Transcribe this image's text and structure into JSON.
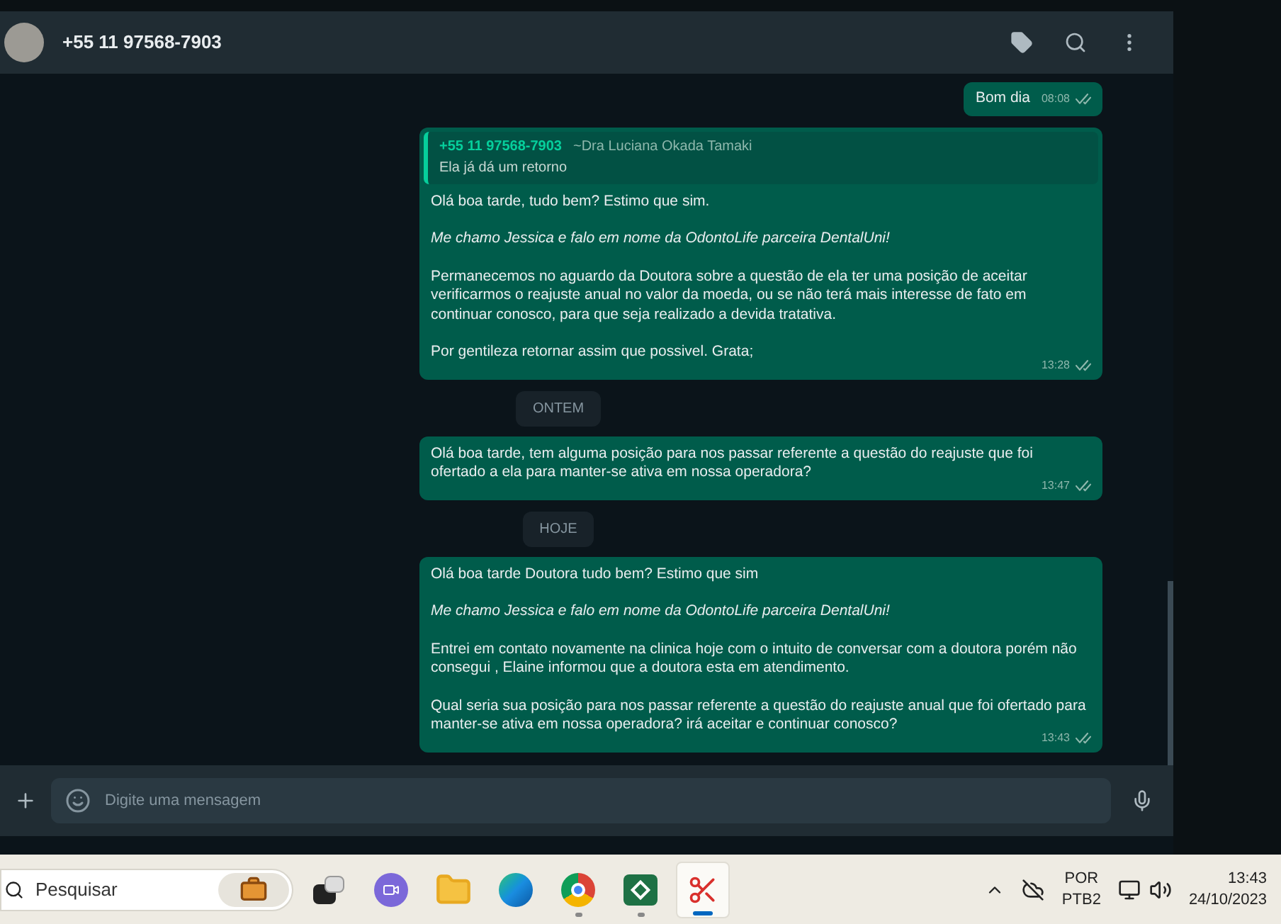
{
  "header": {
    "title": "+55 11 97568-7903"
  },
  "messages": [
    {
      "kind": "plain",
      "paragraphs": [
        {
          "kind": "plain",
          "text": "Bom dia"
        }
      ],
      "time": "08:08",
      "read": true
    },
    {
      "kind": "reply",
      "quote": {
        "sender": "+55 11 97568-7903",
        "name": "~Dra Luciana Okada Tamaki",
        "text": "Ela já dá um retorno"
      },
      "paragraphs": [
        {
          "kind": "plain",
          "text": "Olá boa tarde, tudo bem? Estimo que sim."
        },
        {
          "kind": "italic",
          "text": "Me chamo Jessica e falo em nome da OdontoLife parceira DentalUni!"
        },
        {
          "kind": "plain",
          "text": "Permanecemos no aguardo da Doutora sobre a questão de ela ter uma posição de aceitar verificarmos o reajuste anual no valor da moeda, ou se não terá mais interesse de fato em continuar conosco, para que seja realizado a devida tratativa."
        },
        {
          "kind": "plain",
          "text": "Por gentileza retornar assim que possivel. Grata;"
        }
      ],
      "time": "13:28",
      "read": true
    },
    {
      "kind": "date",
      "text": "ONTEM"
    },
    {
      "kind": "plain",
      "paragraphs": [
        {
          "kind": "plain",
          "text": "Olá boa tarde, tem alguma posição para nos passar referente a questão do reajuste que foi ofertado a ela para manter-se ativa em nossa operadora?"
        }
      ],
      "time": "13:47",
      "read": true
    },
    {
      "kind": "date",
      "text": "HOJE"
    },
    {
      "kind": "plain",
      "paragraphs": [
        {
          "kind": "plain",
          "text": "Olá boa tarde Doutora tudo bem? Estimo que sim"
        },
        {
          "kind": "italic",
          "text": "Me chamo Jessica e falo em nome da OdontoLife parceira DentalUni!"
        },
        {
          "kind": "plain",
          "text": "Entrei em contato novamente na clinica hoje com o intuito de conversar com a doutora porém não consegui , Elaine informou que a doutora esta em atendimento."
        },
        {
          "kind": "plain",
          "text": "Qual seria sua posição para nos passar referente a questão do reajuste anual que foi ofertado para manter-se ativa em nossa operadora? irá aceitar e continuar conosco?"
        }
      ],
      "time": "13:43",
      "read": true
    }
  ],
  "composer": {
    "placeholder": "Digite uma mensagem"
  },
  "taskbar": {
    "search": {
      "placeholder": "Pesquisar"
    },
    "apps": [
      {
        "kind": "taskview",
        "running": false,
        "active": false
      },
      {
        "kind": "meet",
        "running": false,
        "active": false
      },
      {
        "kind": "folder",
        "running": false,
        "active": false
      },
      {
        "kind": "edge",
        "running": false,
        "active": false
      },
      {
        "kind": "chrome",
        "running": true,
        "active": false
      },
      {
        "kind": "excel",
        "running": true,
        "active": false
      },
      {
        "kind": "snip",
        "running": true,
        "active": true
      }
    ],
    "language": [
      "POR",
      "PTB2"
    ],
    "time": "13:43",
    "date": "24/10/2023"
  }
}
